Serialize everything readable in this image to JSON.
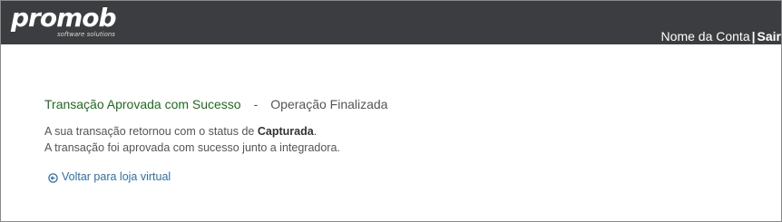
{
  "header": {
    "logo_text": "promob",
    "logo_tagline": "software solutions",
    "account_label": "Nome da Conta",
    "separator": "|",
    "logout_label": "Sair"
  },
  "result": {
    "status_title": "Transação Aprovada com Sucesso",
    "dash": "-",
    "stage_title": "Operação Finalizada",
    "line1_prefix": "A sua transação retornou com o status de ",
    "line1_status": "Capturada",
    "line1_suffix": ".",
    "line2": "A transação foi aprovada com sucesso junto a integradora."
  },
  "back_link": {
    "label": "Voltar para loja virtual",
    "icon": "circle-arrow-left-icon"
  },
  "colors": {
    "topbar": "#3b3d40",
    "success": "#1e6b1e",
    "link": "#2f6fa8"
  }
}
